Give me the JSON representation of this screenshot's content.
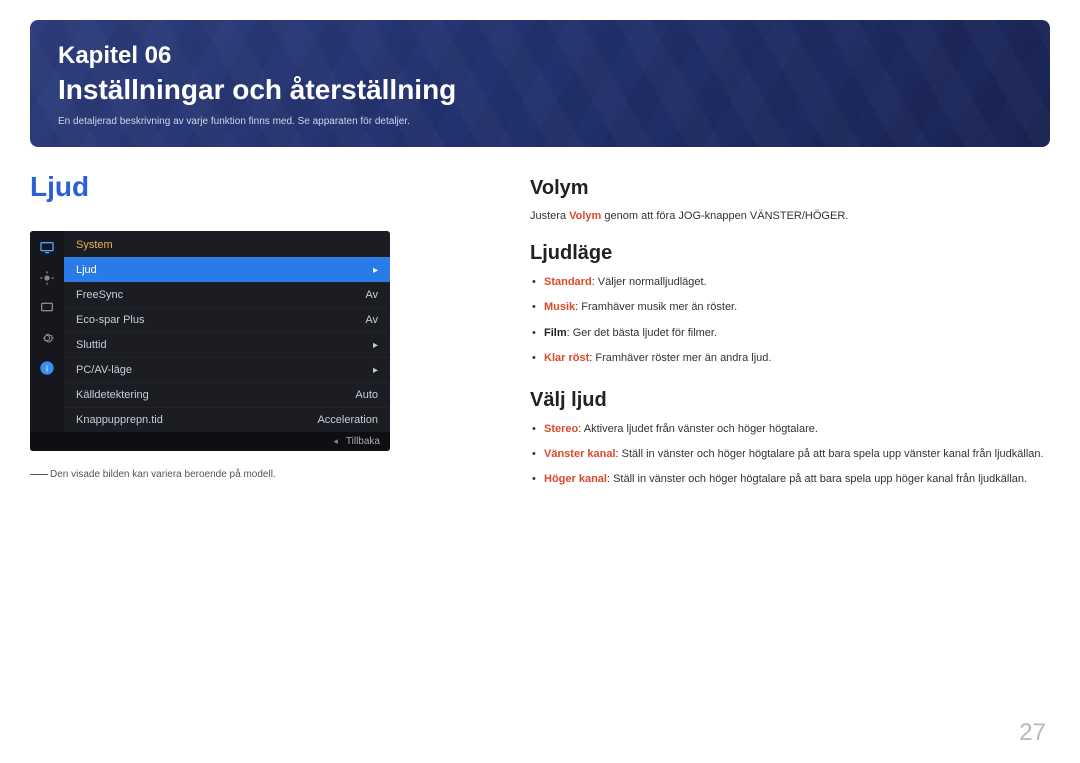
{
  "header": {
    "chapter_label": "Kapitel 06",
    "title": "Inställningar och återställning",
    "description": "En detaljerad beskrivning av varje funktion finns med. Se apparaten för detaljer."
  },
  "left": {
    "section_title": "Ljud",
    "osd": {
      "header": "System",
      "rows": [
        {
          "label": "Ljud",
          "value": "",
          "selected": true,
          "arrow": true
        },
        {
          "label": "FreeSync",
          "value": "Av",
          "selected": false,
          "arrow": false
        },
        {
          "label": "Eco-spar Plus",
          "value": "Av",
          "selected": false,
          "arrow": false
        },
        {
          "label": "Sluttid",
          "value": "",
          "selected": false,
          "arrow": true
        },
        {
          "label": "PC/AV-läge",
          "value": "",
          "selected": false,
          "arrow": true
        },
        {
          "label": "Källdetektering",
          "value": "Auto",
          "selected": false,
          "arrow": false
        },
        {
          "label": "Knappupprepn.tid",
          "value": "Acceleration",
          "selected": false,
          "arrow": false
        }
      ],
      "footer": "Tillbaka"
    },
    "footnote": "Den visade bilden kan variera beroende på modell."
  },
  "right": {
    "volym": {
      "title": "Volym",
      "text_pre": "Justera ",
      "text_hl": "Volym",
      "text_post": " genom att föra JOG-knappen VÄNSTER/HÖGER."
    },
    "ljudlage": {
      "title": "Ljudläge",
      "items": [
        {
          "lead": "Standard",
          "rest": ": Väljer normalljudläget."
        },
        {
          "lead": "Musik",
          "rest": ": Framhäver musik mer än röster."
        },
        {
          "lead_black": "Film",
          "rest": ": Ger det bästa ljudet för filmer."
        },
        {
          "lead": "Klar röst",
          "rest": ": Framhäver röster mer än andra ljud."
        }
      ]
    },
    "valjljud": {
      "title": "Välj ljud",
      "items": [
        {
          "lead": "Stereo",
          "rest": ": Aktivera ljudet från vänster och höger högtalare."
        },
        {
          "lead": "Vänster kanal",
          "rest": ": Ställ in vänster och höger högtalare på att bara spela upp vänster kanal från ljudkällan."
        },
        {
          "lead": "Höger kanal",
          "rest": ": Ställ in vänster och höger högtalare på att bara spela upp höger kanal från ljudkällan."
        }
      ]
    }
  },
  "page_number": "27"
}
